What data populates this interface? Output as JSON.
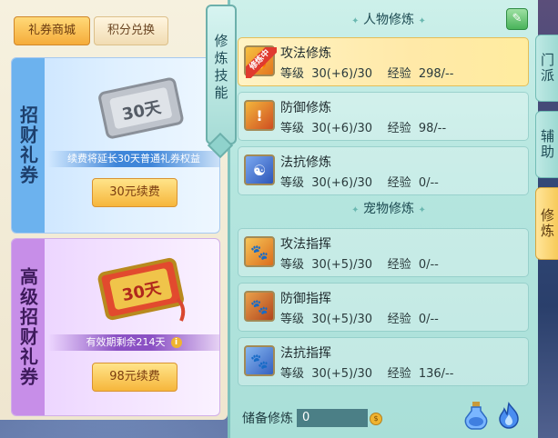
{
  "shop": {
    "tabs": [
      "礼券商城",
      "积分兑换"
    ],
    "cards": [
      {
        "label": "招财礼券",
        "ticket_text": "30天",
        "info": "续费将延长30天普通礼券权益",
        "button": "30元续费"
      },
      {
        "label": "高级招财礼券",
        "ticket_text": "30天",
        "info": "有效期剩余214天",
        "button": "98元续费"
      }
    ]
  },
  "panel": {
    "side_tag": "修炼技能",
    "section_char": "人物修炼",
    "section_pet": "宠物修炼",
    "active_badge": "修炼中",
    "char_skills": [
      {
        "name": "攻法修炼",
        "level": "等级  30(+6)/30",
        "exp": "经验  298/--",
        "icon": "attack-magic-icon"
      },
      {
        "name": "防御修炼",
        "level": "等级  30(+6)/30",
        "exp": "经验  98/--",
        "icon": "defense-icon"
      },
      {
        "name": "法抗修炼",
        "level": "等级  30(+6)/30",
        "exp": "经验  0/--",
        "icon": "magic-resist-icon"
      }
    ],
    "pet_skills": [
      {
        "name": "攻法指挥",
        "level": "等级  30(+5)/30",
        "exp": "经验  0/--",
        "icon": "paw-attack-icon"
      },
      {
        "name": "防御指挥",
        "level": "等级  30(+5)/30",
        "exp": "经验  0/--",
        "icon": "paw-defense-icon"
      },
      {
        "name": "法抗指挥",
        "level": "等级  30(+5)/30",
        "exp": "经验  136/--",
        "icon": "paw-resist-icon"
      }
    ],
    "store_label": "储备修炼",
    "store_value": "0"
  },
  "right_tabs": [
    "门派",
    "辅助",
    "修炼"
  ],
  "colors": {
    "accent": "#f5ac3a",
    "panel": "#b5e6df",
    "selected_row": "#ffe9a8"
  }
}
